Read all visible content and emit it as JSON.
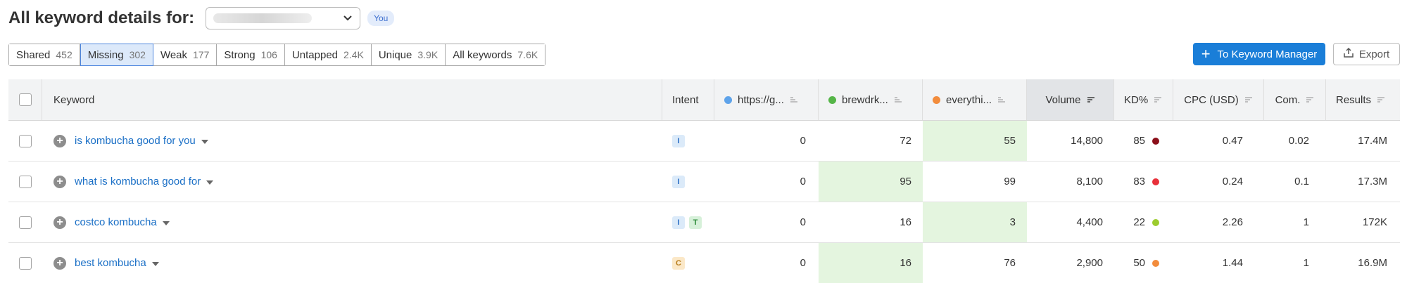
{
  "header": {
    "title": "All keyword details for:",
    "you_badge": "You"
  },
  "tabs": [
    {
      "label": "Shared",
      "count": "452",
      "active": false
    },
    {
      "label": "Missing",
      "count": "302",
      "active": true
    },
    {
      "label": "Weak",
      "count": "177",
      "active": false
    },
    {
      "label": "Strong",
      "count": "106",
      "active": false
    },
    {
      "label": "Untapped",
      "count": "2.4K",
      "active": false
    },
    {
      "label": "Unique",
      "count": "3.9K",
      "active": false
    },
    {
      "label": "All keywords",
      "count": "7.6K",
      "active": false
    }
  ],
  "actions": {
    "keyword_manager": "To Keyword Manager",
    "export": "Export"
  },
  "columns": {
    "keyword": "Keyword",
    "intent": "Intent",
    "domain1": "https://g...",
    "domain2": "brewdrk...",
    "domain3": "everythi...",
    "volume": "Volume",
    "kd": "KD%",
    "cpc": "CPC (USD)",
    "com": "Com.",
    "results": "Results"
  },
  "colors": {
    "domain1": "#5ea3ea",
    "domain2": "#55b548",
    "domain3": "#f28c3c",
    "kd_very_hard": "#8b0f1a",
    "kd_hard": "#e8303a",
    "kd_possible": "#9ccc2e",
    "kd_difficult": "#f28c3c"
  },
  "rows": [
    {
      "keyword": "is kombucha good for you",
      "intents": [
        "I"
      ],
      "d1": "0",
      "d2": "72",
      "d3": "55",
      "volume": "14,800",
      "kd": "85",
      "kd_color": "#8b0f1a",
      "cpc": "0.47",
      "com": "0.02",
      "results": "17.4M",
      "hl": "d3"
    },
    {
      "keyword": "what is kombucha good for",
      "intents": [
        "I"
      ],
      "d1": "0",
      "d2": "95",
      "d3": "99",
      "volume": "8,100",
      "kd": "83",
      "kd_color": "#e8303a",
      "cpc": "0.24",
      "com": "0.1",
      "results": "17.3M",
      "hl": "d2"
    },
    {
      "keyword": "costco kombucha",
      "intents": [
        "I",
        "T"
      ],
      "d1": "0",
      "d2": "16",
      "d3": "3",
      "volume": "4,400",
      "kd": "22",
      "kd_color": "#9ccc2e",
      "cpc": "2.26",
      "com": "1",
      "results": "172K",
      "hl": "d3"
    },
    {
      "keyword": "best kombucha",
      "intents": [
        "C"
      ],
      "d1": "0",
      "d2": "16",
      "d3": "76",
      "volume": "2,900",
      "kd": "50",
      "kd_color": "#f28c3c",
      "cpc": "1.44",
      "com": "1",
      "results": "16.9M",
      "hl": "d2"
    }
  ]
}
